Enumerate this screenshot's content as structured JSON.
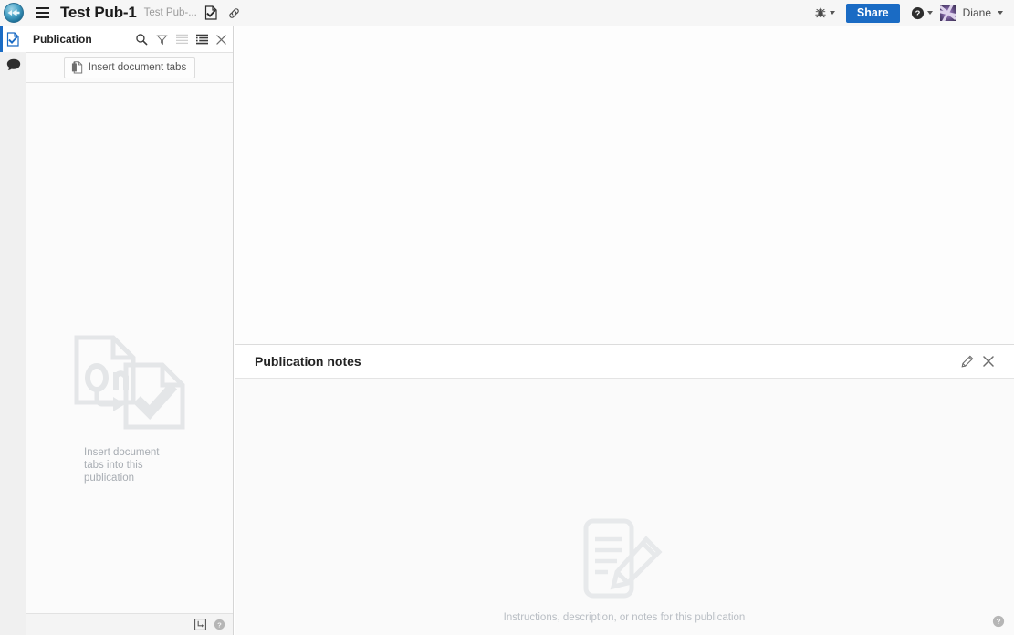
{
  "topbar": {
    "logo_icon": "app-logo-icon",
    "menu_icon": "hamburger-menu-icon",
    "title": "Test Pub-1",
    "subtitle": "Test Pub-...",
    "doc_check_icon": "document-check-icon",
    "link_icon": "link-icon",
    "bug_icon": "bug-icon",
    "share_label": "Share",
    "help_icon": "help-circle-icon",
    "user_name": "Diane",
    "avatar_icon": "user-avatar",
    "accent_color": "#1a6bc4"
  },
  "rail": {
    "items": [
      {
        "name": "publication-tab",
        "icon": "document-check-icon",
        "active": true
      },
      {
        "name": "comments-tab",
        "icon": "comment-bubble-icon",
        "active": false
      }
    ]
  },
  "panel": {
    "title": "Publication",
    "tools": [
      {
        "name": "search-icon",
        "label": "Search"
      },
      {
        "name": "filter-icon",
        "label": "Filter"
      },
      {
        "name": "list-view-icon",
        "label": "List view"
      },
      {
        "name": "tree-view-icon",
        "label": "Tree view"
      },
      {
        "name": "close-icon",
        "label": "Close"
      }
    ],
    "insert_tabs_label": "Insert document tabs",
    "insert_tabs_icon": "insert-document-icon",
    "empty_text": "Insert document tabs into this publication",
    "empty_illustration": "documents-check-illustration",
    "footer": [
      {
        "name": "panel-layout-icon",
        "label": "Panel layout"
      },
      {
        "name": "help-circle-icon",
        "label": "Help"
      }
    ]
  },
  "notes": {
    "title": "Publication notes",
    "edit_icon": "pencil-edit-icon",
    "close_icon": "close-icon",
    "empty_text": "Instructions, description, or notes for this publication",
    "empty_illustration": "notepad-pencil-illustration",
    "help_icon": "help-circle-icon"
  }
}
